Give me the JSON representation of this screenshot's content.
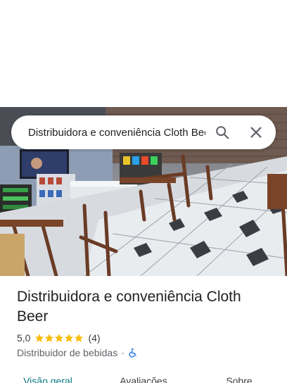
{
  "search": {
    "query": "Distribuidora e conveniência Cloth Beer",
    "search_icon": "search-icon",
    "close_icon": "close-icon"
  },
  "place": {
    "name": "Distribuidora e conveniência Cloth Beer",
    "rating": "5,0",
    "stars": 5,
    "review_count": "(4)",
    "category": "Distribuidor de bebidas",
    "separator": "·",
    "accessibility_icon": "wheelchair-icon"
  },
  "tabs": [
    {
      "label": "Visão geral",
      "active": true
    },
    {
      "label": "Avaliações",
      "active": false
    },
    {
      "label": "Sobre",
      "active": false
    }
  ],
  "colors": {
    "accent": "#0b7b84",
    "star": "#fbbc04",
    "accessibility": "#1a73e8"
  }
}
